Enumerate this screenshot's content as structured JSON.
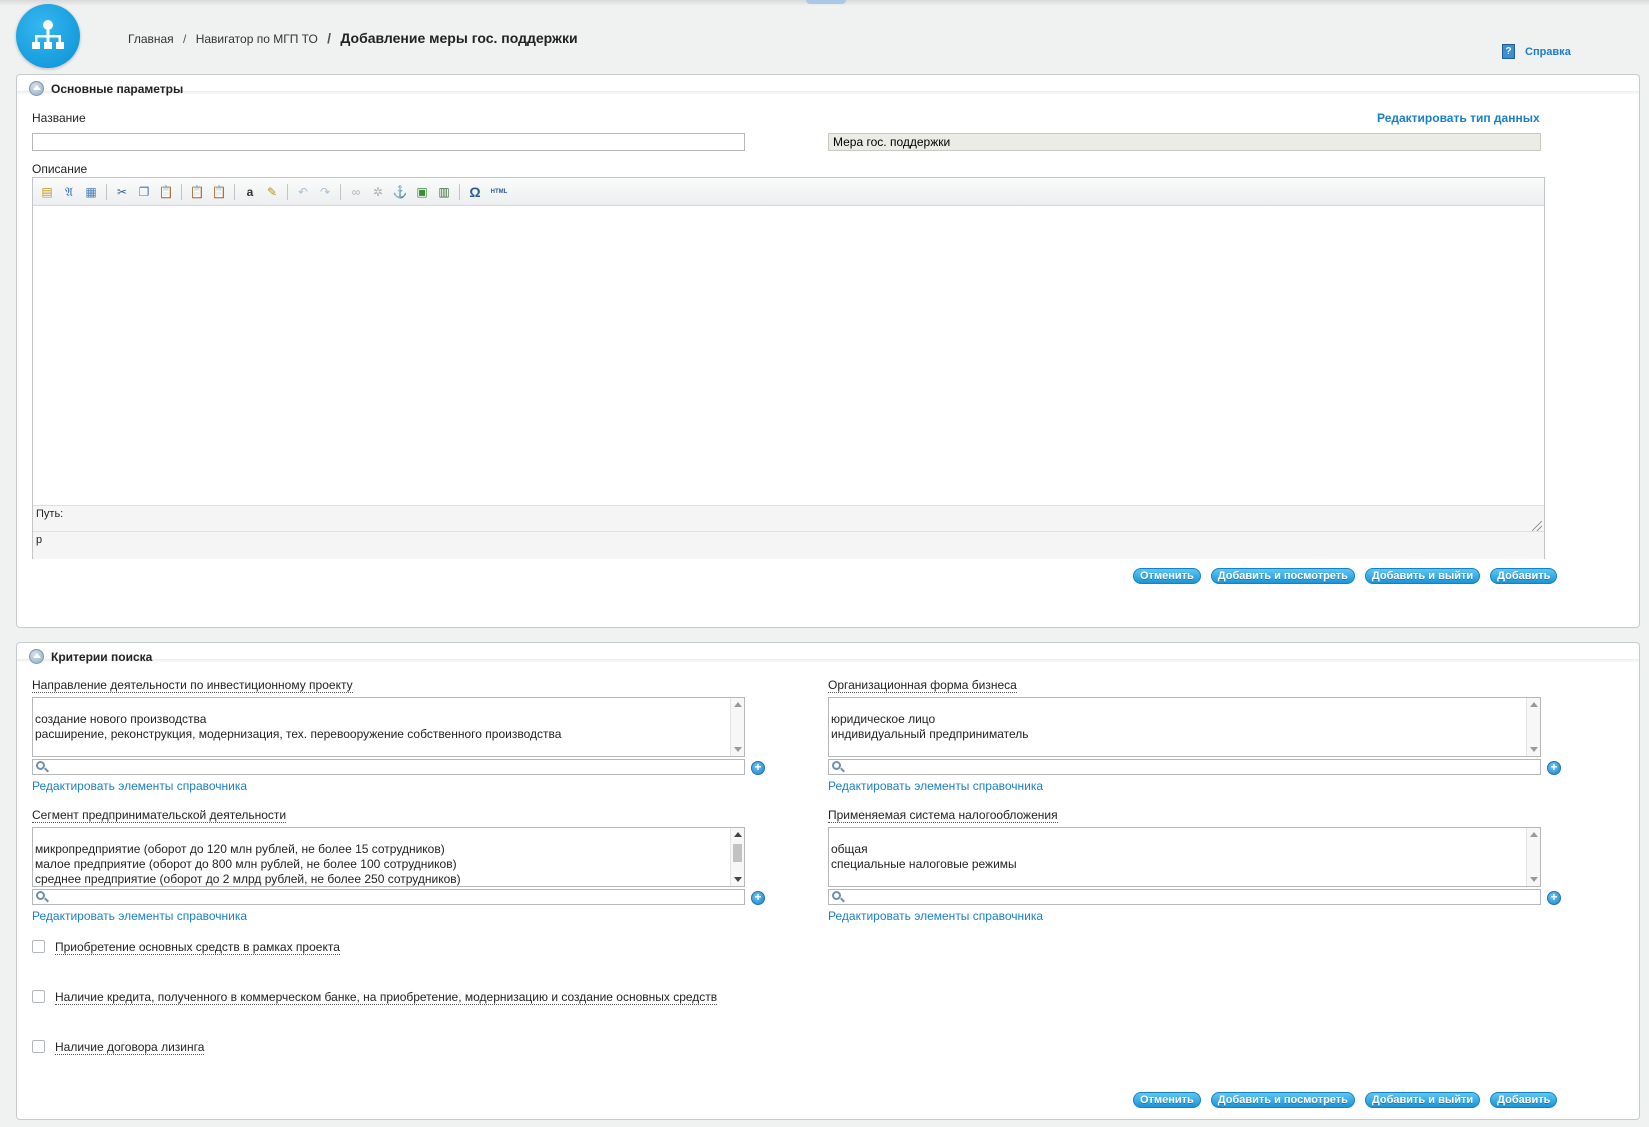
{
  "breadcrumb": {
    "home": "Главная",
    "section": "Навигатор по МГП ТО",
    "separator": "/",
    "current": "Добавление меры гос. поддержки"
  },
  "help": {
    "label": "Справка"
  },
  "main_params": {
    "title": "Основные параметры",
    "name_label": "Название",
    "name_value": "",
    "edit_type_link": "Редактировать тип данных",
    "type_value": "Мера гос. поддержки",
    "description_label": "Описание",
    "path_label": "Путь:",
    "path_value": "p",
    "toolbar_icons": [
      "new-page-icon",
      "templates-icon",
      "table-icon",
      "cut-icon",
      "copy-icon",
      "paste-icon",
      "paste-text-icon",
      "paste-word-icon",
      "find-icon",
      "remove-format-icon",
      "undo-icon",
      "redo-icon",
      "link-icon",
      "unlink-icon",
      "anchor-icon",
      "image-icon",
      "flash-icon",
      "special-char-icon",
      "html-source-icon"
    ]
  },
  "buttons": {
    "cancel": "Отменить",
    "add_view": "Добавить и посмотреть",
    "add_exit": "Добавить и выйти",
    "add": "Добавить"
  },
  "search_criteria": {
    "title": "Критерии поиска",
    "edit_ref_link": "Редактировать элементы справочника",
    "direction": {
      "label": "Направление деятельности по инвестиционному проекту",
      "items": [
        "создание нового производства",
        "расширение, реконструкция, модернизация, тех. перевооружение собственного производства"
      ]
    },
    "org_form": {
      "label": "Организационная форма бизнеса",
      "items": [
        "юридическое лицо",
        "индивидуальный предприниматель"
      ]
    },
    "segment": {
      "label": "Сегмент предпринимательской деятельности",
      "items": [
        "микропредприятие (оборот до 120 млн рублей, не более 15 сотрудников)",
        "малое предприятие (оборот до 800 млн рублей, не более 100 сотрудников)",
        "среднее предприятие (оборот до 2 млрд рублей, не более 250 сотрудников)"
      ]
    },
    "tax_system": {
      "label": "Применяемая система налогообложения",
      "items": [
        "общая",
        "специальные налоговые режимы"
      ]
    },
    "checkboxes": [
      {
        "label": "Приобретение основных средств в рамках проекта",
        "checked": false
      },
      {
        "label": "Наличие кредита, полученного в коммерческом банке, на приобретение, модернизацию и создание основных средств",
        "checked": false
      },
      {
        "label": "Наличие договора лизинга",
        "checked": false
      }
    ]
  },
  "colors": {
    "accent": "#1a7fc8",
    "button": "#1a95d8",
    "logo": "#0a91d6",
    "background": "#f0f1f1"
  }
}
